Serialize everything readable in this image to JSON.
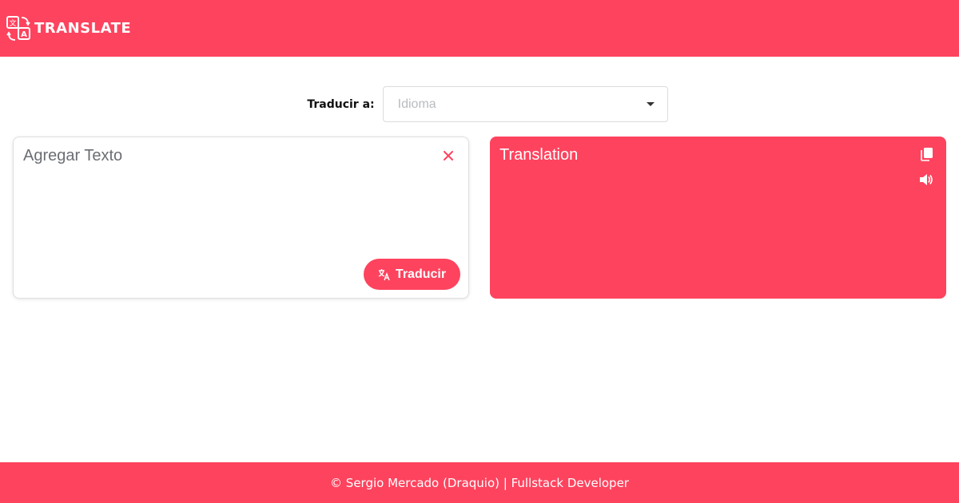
{
  "header": {
    "brand": "TRANSLATE",
    "logo_icon": "translate-icon",
    "background": "#fe435e"
  },
  "language": {
    "label": "Traducir a:",
    "placeholder": "Idioma"
  },
  "input_card": {
    "placeholder": "Agregar Texto",
    "clear_icon": "close-icon",
    "translate_button": "Traducir",
    "translate_icon": "translate-icon"
  },
  "output_card": {
    "text": "Translation",
    "copy_icon": "copy-icon",
    "speak_icon": "volume-icon"
  },
  "footer": {
    "text": "© Sergio Mercado (Draquio) | Fullstack Developer"
  },
  "colors": {
    "accent": "#fe435e",
    "background": "#ffffff"
  }
}
